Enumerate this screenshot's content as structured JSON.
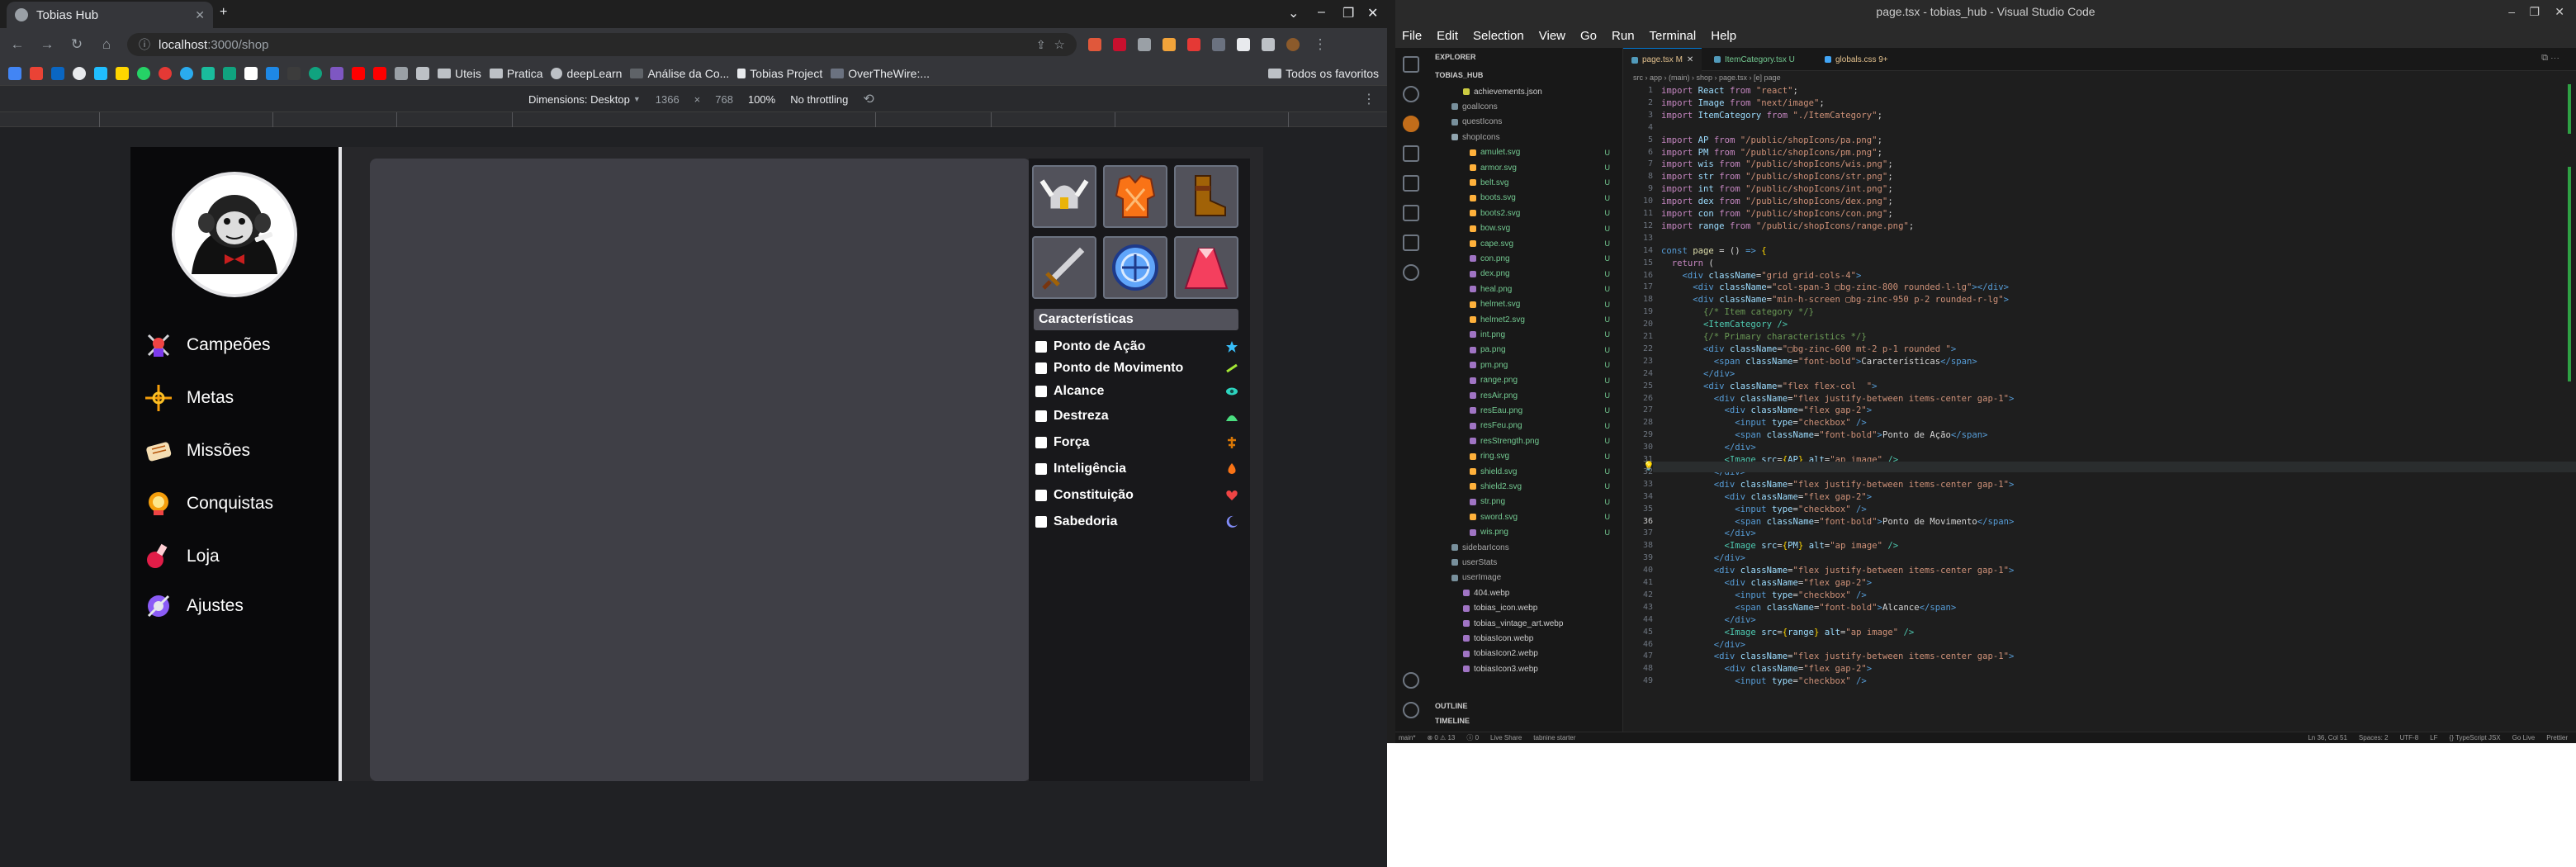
{
  "chrome": {
    "tab_title": "Tobias Hub",
    "url_host": "localhost",
    "url_path": ":3000/shop",
    "bookmarks": [
      "Uteis",
      "Pratica",
      "deepLearn",
      "Análise da Co...",
      "Tobias Project",
      "OverTheWire:..."
    ],
    "all_bookmarks": "Todos os favoritos",
    "devtools": {
      "dimensions": "Dimensions: Desktop",
      "width": "1366",
      "x": "×",
      "height": "768",
      "zoom": "100%",
      "throttle": "No throttling"
    }
  },
  "site": {
    "nav": [
      {
        "label": "Campeões",
        "icon": "sword-man-icon"
      },
      {
        "label": "Metas",
        "icon": "target-icon"
      },
      {
        "label": "Missões",
        "icon": "scroll-icon"
      },
      {
        "label": "Conquistas",
        "icon": "trophy-icon"
      },
      {
        "label": "Loja",
        "icon": "potion-icon"
      },
      {
        "label": "Ajustes",
        "icon": "gear-icon"
      }
    ],
    "slots": [
      "helmet-icon",
      "armor-icon",
      "boots-icon",
      "sword-icon",
      "shield-icon",
      "cape-icon"
    ],
    "characteristics_title": "Características",
    "characteristics": [
      {
        "label": "Ponto de Ação",
        "color": "#38bdf8"
      },
      {
        "label": "Ponto de Movimento",
        "color": "#a3e635"
      },
      {
        "label": "Alcance",
        "color": "#2dd4bf"
      },
      {
        "label": "Destreza",
        "color": "#4ade80"
      },
      {
        "label": "Força",
        "color": "#d97706"
      },
      {
        "label": "Inteligência",
        "color": "#f97316"
      },
      {
        "label": "Constituição",
        "color": "#ef4444"
      },
      {
        "label": "Sabedoria",
        "color": "#818cf8"
      }
    ]
  },
  "vscode": {
    "title": "page.tsx - tobias_hub - Visual Studio Code",
    "menu": [
      "File",
      "Edit",
      "Selection",
      "View",
      "Go",
      "Run",
      "Terminal",
      "Help"
    ],
    "explorer_title": "EXPLORER",
    "project": "TOBIAS_HUB",
    "files": [
      {
        "name": "achievements.json",
        "kind": "file",
        "u": ""
      },
      {
        "name": "goalIcons",
        "kind": "folder",
        "u": ""
      },
      {
        "name": "questIcons",
        "kind": "folder",
        "u": ""
      },
      {
        "name": "shopIcons",
        "kind": "folder-open",
        "u": ""
      },
      {
        "name": "amulet.svg",
        "kind": "file",
        "u": "U"
      },
      {
        "name": "armor.svg",
        "kind": "file",
        "u": "U"
      },
      {
        "name": "belt.svg",
        "kind": "file",
        "u": "U"
      },
      {
        "name": "boots.svg",
        "kind": "file",
        "u": "U"
      },
      {
        "name": "boots2.svg",
        "kind": "file",
        "u": "U"
      },
      {
        "name": "bow.svg",
        "kind": "file",
        "u": "U"
      },
      {
        "name": "cape.svg",
        "kind": "file",
        "u": "U"
      },
      {
        "name": "con.png",
        "kind": "file",
        "u": "U"
      },
      {
        "name": "dex.png",
        "kind": "file",
        "u": "U"
      },
      {
        "name": "heal.png",
        "kind": "file",
        "u": "U"
      },
      {
        "name": "helmet.svg",
        "kind": "file",
        "u": "U"
      },
      {
        "name": "helmet2.svg",
        "kind": "file",
        "u": "U"
      },
      {
        "name": "int.png",
        "kind": "file",
        "u": "U"
      },
      {
        "name": "pa.png",
        "kind": "file",
        "u": "U"
      },
      {
        "name": "pm.png",
        "kind": "file",
        "u": "U"
      },
      {
        "name": "range.png",
        "kind": "file",
        "u": "U"
      },
      {
        "name": "resAir.png",
        "kind": "file",
        "u": "U"
      },
      {
        "name": "resEau.png",
        "kind": "file",
        "u": "U"
      },
      {
        "name": "resFeu.png",
        "kind": "file",
        "u": "U"
      },
      {
        "name": "resStrength.png",
        "kind": "file",
        "u": "U"
      },
      {
        "name": "ring.svg",
        "kind": "file",
        "u": "U"
      },
      {
        "name": "shield.svg",
        "kind": "file",
        "u": "U"
      },
      {
        "name": "shield2.svg",
        "kind": "file",
        "u": "U"
      },
      {
        "name": "str.png",
        "kind": "file",
        "u": "U"
      },
      {
        "name": "sword.svg",
        "kind": "file",
        "u": "U"
      },
      {
        "name": "wis.png",
        "kind": "file",
        "u": "U"
      },
      {
        "name": "sidebarIcons",
        "kind": "folder",
        "u": ""
      },
      {
        "name": "userStats",
        "kind": "folder",
        "u": ""
      },
      {
        "name": "userImage",
        "kind": "folder",
        "u": ""
      },
      {
        "name": "404.webp",
        "kind": "file",
        "u": ""
      },
      {
        "name": "tobias_icon.webp",
        "kind": "file",
        "u": ""
      },
      {
        "name": "tobias_vintage_art.webp",
        "kind": "file",
        "u": ""
      },
      {
        "name": "tobiasIcon.webp",
        "kind": "file",
        "u": ""
      },
      {
        "name": "tobiasIcon2.webp",
        "kind": "file",
        "u": ""
      },
      {
        "name": "tobiasIcon3.webp",
        "kind": "file",
        "u": ""
      }
    ],
    "outline": "OUTLINE",
    "timeline": "TIMELINE",
    "tabs": [
      "page.tsx M",
      "ItemCategory.tsx U",
      "globals.css 9+"
    ],
    "breadcrumb": "src › app › (main) › shop › page.tsx › [e] page",
    "status": [
      "main*",
      "⊗ 0 ⚠ 13",
      "ⓘ 0",
      "Live Share",
      "tabnine starter",
      "Ln 36, Col 51",
      "Spaces: 2",
      "UTF-8",
      "LF",
      "{} TypeScript JSX",
      "Go Live",
      "Prettier"
    ]
  }
}
